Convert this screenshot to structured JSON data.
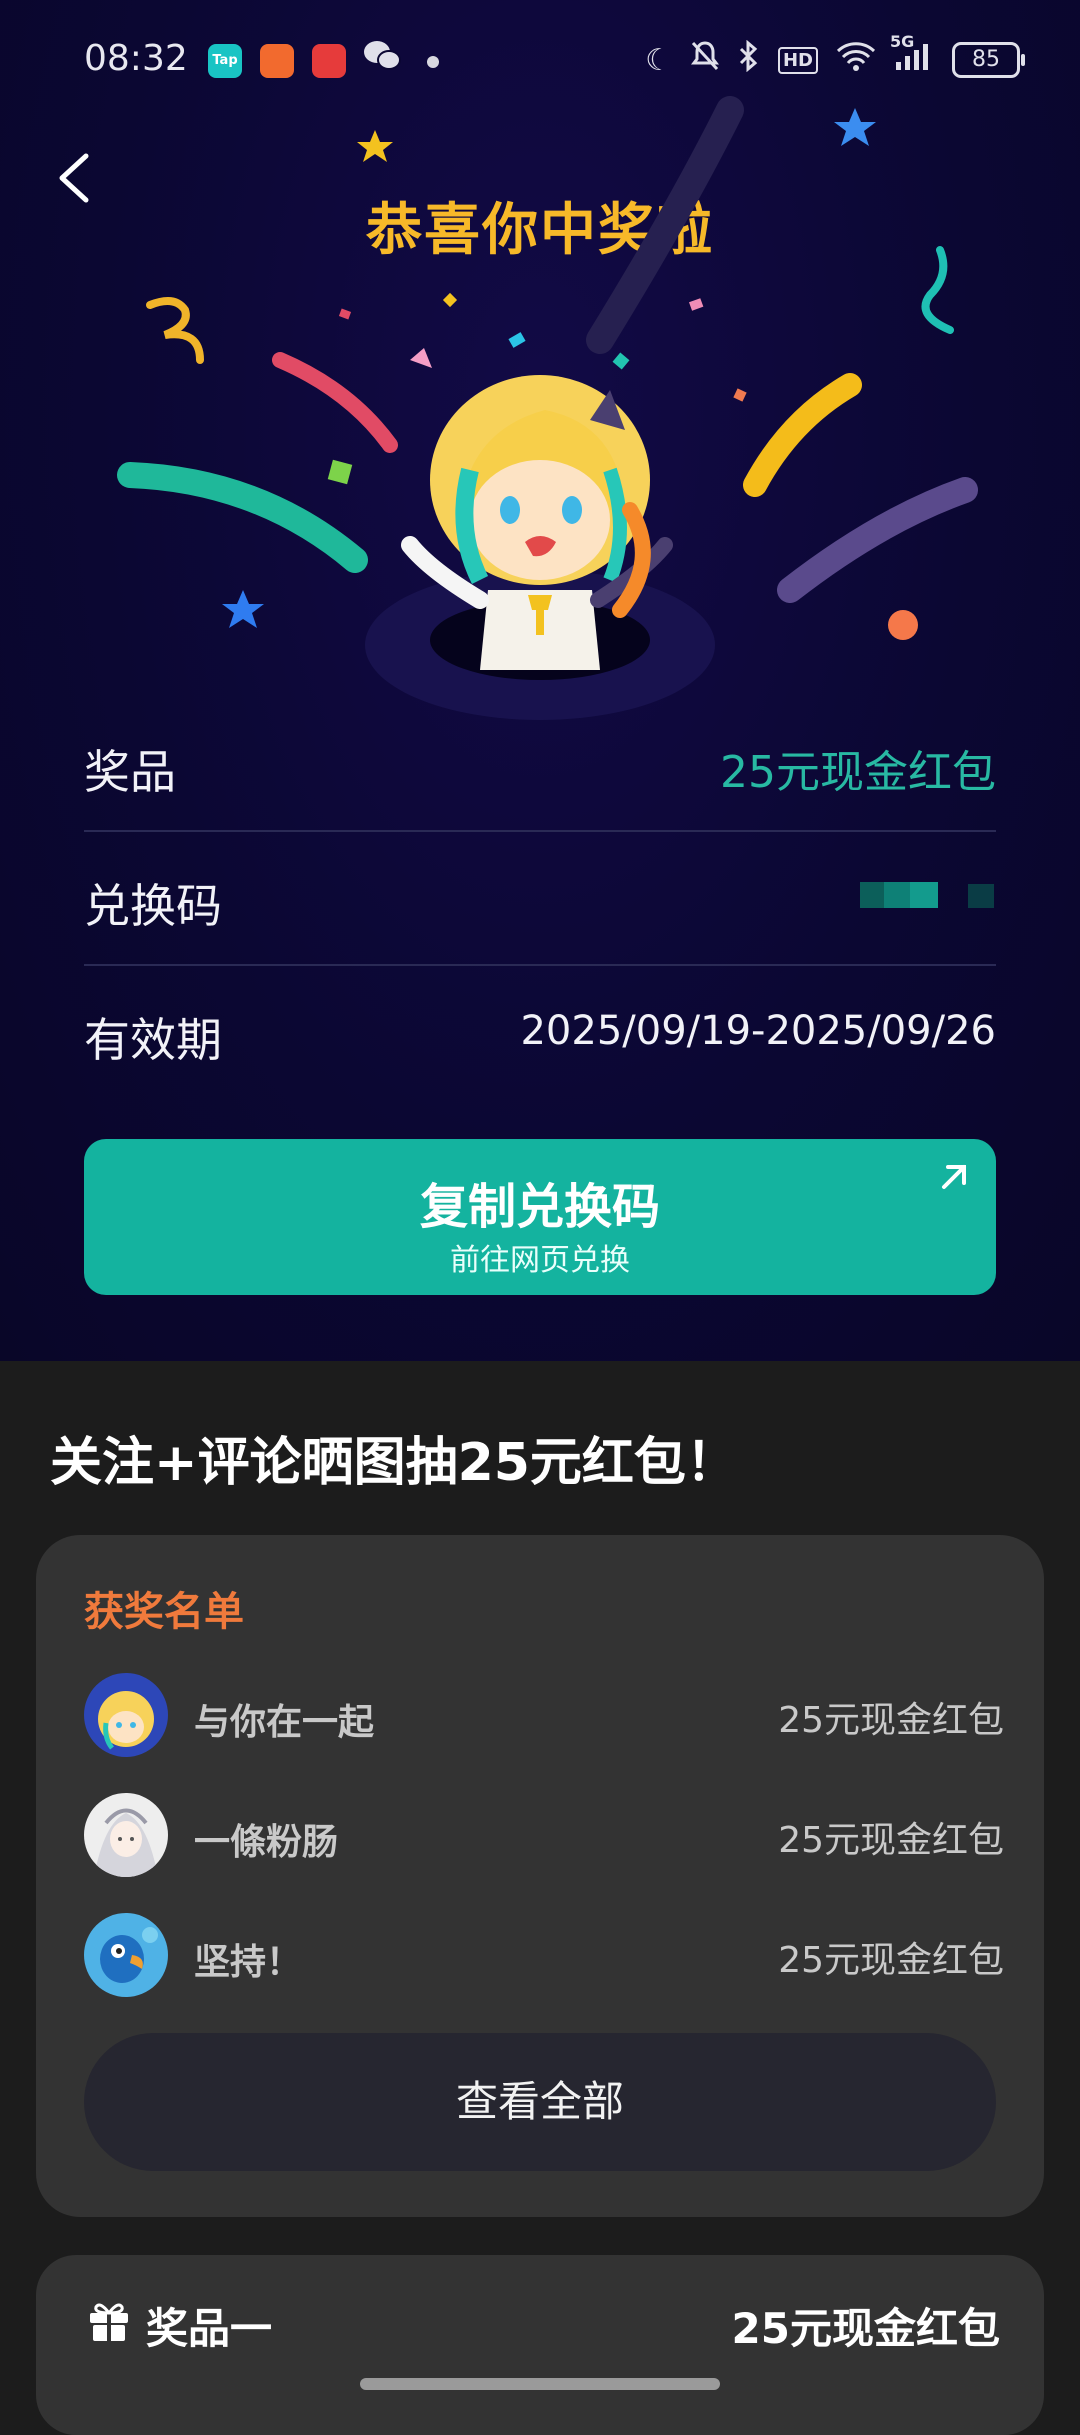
{
  "status_bar": {
    "time": "08:32",
    "tap_app_label": "Tap",
    "battery": "85",
    "network": "5G",
    "hd_badge": "HD"
  },
  "header": {
    "title": "恭喜你中奖啦"
  },
  "prize_details": {
    "prize_label": "奖品",
    "prize_value": "25元现金红包",
    "code_label": "兑换码",
    "validity_label": "有效期",
    "validity_value": "2025/09/19-2025/09/26"
  },
  "copy_button": {
    "label": "复制兑换码",
    "sublabel": "前往网页兑换"
  },
  "promo": {
    "headline": "关注+评论晒图抽25元红包！"
  },
  "winners_card": {
    "title": "获奖名单",
    "winners": [
      {
        "name": "与你在一起",
        "prize": "25元现金红包"
      },
      {
        "name": "一條粉肠",
        "prize": "25元现金红包"
      },
      {
        "name": "坚持！",
        "prize": "25元现金红包"
      }
    ],
    "view_all_label": "查看全部"
  },
  "prize_card": {
    "label": "奖品一",
    "value": "25元现金红包"
  },
  "colors": {
    "accent_teal": "#14b39f",
    "title_gold": "#f7b929",
    "winners_orange": "#f07a3c",
    "background_top": "#0b0733"
  }
}
